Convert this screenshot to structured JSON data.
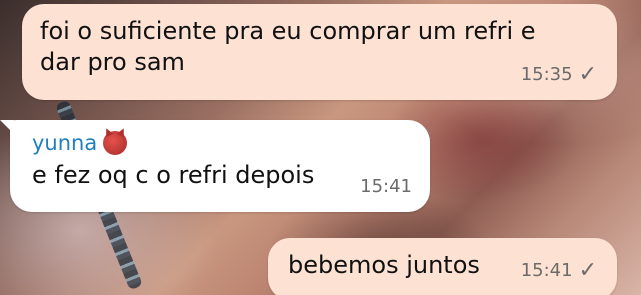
{
  "messages": [
    {
      "direction": "outgoing",
      "text_line1": "foi o suficiente pra eu comprar um refri e",
      "text_line2": "dar pro sam",
      "time": "15:35",
      "status_icon": "check-icon"
    },
    {
      "direction": "incoming",
      "sender": "yunna",
      "sender_emoji": "devil-icon",
      "text": "e fez oq c o refri depois",
      "time": "15:41"
    },
    {
      "direction": "outgoing",
      "text": "bebemos juntos",
      "time": "15:41",
      "status_icon": "check-icon"
    }
  ],
  "colors": {
    "outgoing_bubble": "#fde1d3",
    "incoming_bubble": "#ffffff",
    "sender_name": "#1f7fbf",
    "meta_text": "#6b6b6b"
  },
  "check_glyph": "✓"
}
